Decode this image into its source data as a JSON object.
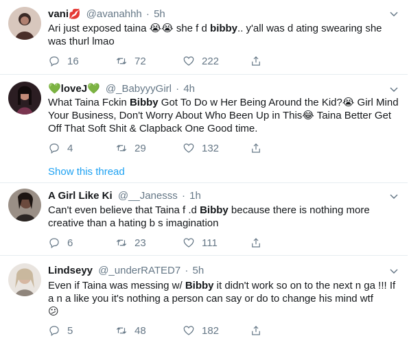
{
  "tweets": [
    {
      "name": "vani",
      "name_emoji": "💋",
      "handle": "@avanahhh",
      "dot": "·",
      "time": "5h",
      "text_a": "Ari just exposed taina",
      "emoji_a": "😭😭",
      "text_b": " she f      d ",
      "bold_1": "bibby",
      "text_c": ".. y'all was d     ating swearing she was thurl lmao",
      "replies": "16",
      "retweets": "72",
      "likes": "222"
    },
    {
      "name": "💚loveJ💚",
      "handle": "@_BabyyyGirl",
      "dot": "·",
      "time": "4h",
      "text_a": "What Taina Fckin ",
      "bold_1": "Bibby",
      "text_b": " Got To Do w Her Being Around the Kid?",
      "emoji_a": "😭",
      "text_c": " Girl Mind Your Business, Don't Worry About Who Been Up in This",
      "emoji_b": "😂",
      "text_d": " Taina Better Get Off That Soft Shit & Clapback One Good time.",
      "replies": "4",
      "retweets": "29",
      "likes": "132",
      "show_thread": "Show this thread"
    },
    {
      "name": "A Girl Like Ki",
      "handle": "@__Janesss",
      "dot": "·",
      "time": "1h",
      "text_a": "Can't even believe that Taina f     .d ",
      "bold_1": "Bibby",
      "text_b": " because there is nothing more creative than a hating b      s imagination",
      "replies": "6",
      "retweets": "23",
      "likes": "111"
    },
    {
      "name": "Lindseyy",
      "handle": "@_underRATED7",
      "dot": "·",
      "time": "5h",
      "text_a": "Even if Taina was messing w/ ",
      "bold_1": "Bibby",
      "text_b": " it didn't work so on to the next n  ga !!! If a n  a like you it's nothing a person can say or do to change his mind wtf",
      "emoji_a": "😕",
      "replies": "5",
      "retweets": "48",
      "likes": "182"
    }
  ]
}
